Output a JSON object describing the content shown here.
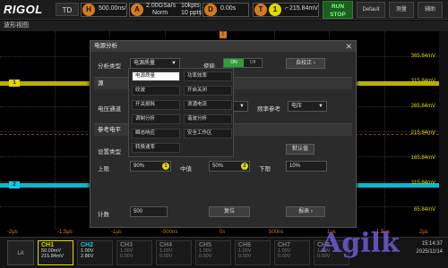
{
  "topbar": {
    "logo": "RIGOL",
    "mode": "TD",
    "h_icon": "H",
    "timebase": "500.00ns/",
    "a_icon": "A",
    "sample_rate": "2.00GSa/s",
    "acq_mode": "Norm",
    "mem_depth": "10kpts",
    "mem_depth2": "10 ppts",
    "d_icon": "D",
    "delay": "0.00s",
    "t_icon": "T",
    "trigger_ch": "1",
    "trigger_level": "215.84mV",
    "trigger_slope_icon": "rising-edge-icon",
    "run_label": "RUN",
    "stop_label": "STOP",
    "default_label": "Default",
    "measure_label": "测量",
    "utility_label": "辅助"
  },
  "window": {
    "title": "波形视图"
  },
  "screen": {
    "volt_labels": [
      "365.84mV",
      "315.84mV",
      "265.84mV",
      "215.84mV",
      "165.84mV",
      "115.84mV",
      "65.84mV"
    ],
    "time_labels": [
      "-2μs",
      "-1.5μs",
      "-1μs",
      "-500ns",
      "0s",
      "500ns",
      "1μs",
      "1.5μs",
      "2μs"
    ],
    "ch1_marker": "1",
    "ch2_marker": "2",
    "trigger_marker": "T"
  },
  "dialog": {
    "title": "电源分析",
    "analysis_type_label": "分析类型",
    "analysis_type_value": "电源质量",
    "enable_label": "使能",
    "toggle_on": "ON",
    "toggle_off": "Off",
    "auto_setup": "自校正",
    "source_label": "源",
    "voltage_channel_label": "电压通道",
    "freq_ref_label": "频率参考",
    "freq_ref_value": "电压",
    "ref_level_label": "参考电平",
    "setup_type_label": "设置类型",
    "default_btn": "默认值",
    "upper_label": "上限",
    "upper_value": "90%",
    "mid_label": "中值",
    "mid_value": "50%",
    "lower_label": "下限",
    "lower_value": "10%",
    "badge1": "1",
    "badge2": "2",
    "count_label": "计数",
    "count_value": "500",
    "reset_btn": "复位",
    "report_btn": "报表",
    "menu_items": [
      "电源质量",
      "功率效率",
      "纹波",
      "开启关闭",
      "开关损耗",
      "浪涌电流",
      "调制分析",
      "谐波分析",
      "瞬态响应",
      "安全工作区",
      "转换速率"
    ]
  },
  "channels": [
    {
      "name": "CH1",
      "line1": "50.00mV",
      "line2": "215.84mV"
    },
    {
      "name": "CH2",
      "line1": "1.00V",
      "line2": "2.86V"
    },
    {
      "name": "CH3",
      "line1": "1.00V",
      "line2": "0.00V"
    },
    {
      "name": "CH4",
      "line1": "1.00V",
      "line2": "0.00V"
    },
    {
      "name": "CH5",
      "line1": "1.00V",
      "line2": "0.00V"
    },
    {
      "name": "CH6",
      "line1": "1.00V",
      "line2": "0.00V"
    },
    {
      "name": "CH7",
      "line1": "1.00V",
      "line2": "0.00V"
    },
    {
      "name": "CH8",
      "line1": "1.00V",
      "line2": "0.00V"
    }
  ],
  "la_label": "LA",
  "status": {
    "time": "15:14:37",
    "date": "2025/11/14"
  },
  "watermark": "Agilk",
  "colors": {
    "ch1": "#e2d800",
    "ch2": "#14c8e0",
    "trigger": "#d87a1a",
    "accent_green": "#2e9e38"
  }
}
